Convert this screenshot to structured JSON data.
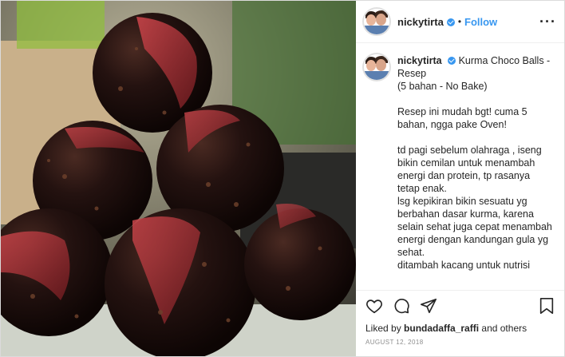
{
  "header": {
    "username": "nickytirta",
    "separator": "•",
    "follow_label": "Follow",
    "more_label": "···"
  },
  "caption": {
    "username": "nickytirta",
    "title_lines": "Kurma Choco Balls - Resep\n(5 bahan - No Bake)",
    "para1": "Resep ini mudah bgt! cuma 5 bahan, ngga pake Oven!",
    "para2": "td pagi sebelum olahraga , iseng bikin cemilan untuk menambah energi dan protein, tp rasanya tetap enak.\nlsg kepikiran bikin sesuatu yg berbahan dasar kurma, karena selain sehat juga cepat menambah energi dengan kandungan gula yg sehat.\nditambah kacang untuk nutrisi protein nya..\nnah biar enak, di balur dengan dark chocolate..yummm!",
    "more_text": ".."
  },
  "likes": {
    "prefix": "Liked by",
    "user": "bundadaffa_raffi",
    "suffix": "and others"
  },
  "date": "AUGUST 12, 2018",
  "icons": {
    "like": "heart-icon",
    "comment": "comment-icon",
    "share": "share-icon",
    "save": "bookmark-icon",
    "verified": "verified-badge-icon"
  },
  "colors": {
    "link_blue": "#3897f0",
    "text": "#262626",
    "muted": "#8e8e8e"
  }
}
